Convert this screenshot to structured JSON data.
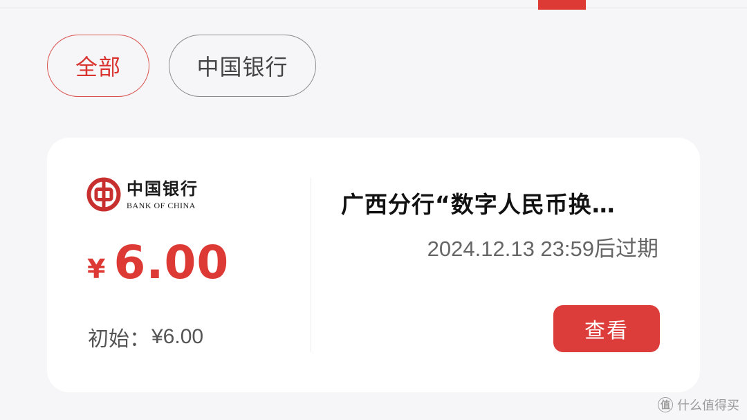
{
  "filters": {
    "all_label": "全部",
    "bank_label": "中国银行"
  },
  "card": {
    "bank_logo": {
      "name_cn": "中国银行",
      "name_en": "BANK OF CHINA",
      "icon": "bank-of-china-logo"
    },
    "amount": {
      "currency": "¥",
      "value": "6.00"
    },
    "initial": {
      "label": "初始：",
      "value": "¥6.00"
    },
    "title": "广西分行“数字人民币换…",
    "expiry": "2024.12.13 23:59后过期",
    "view_button_label": "查看"
  },
  "watermark": {
    "text": "什么值得买"
  },
  "colors": {
    "accent": "#dd3a35",
    "background": "#f6f6f8",
    "card": "#ffffff"
  }
}
